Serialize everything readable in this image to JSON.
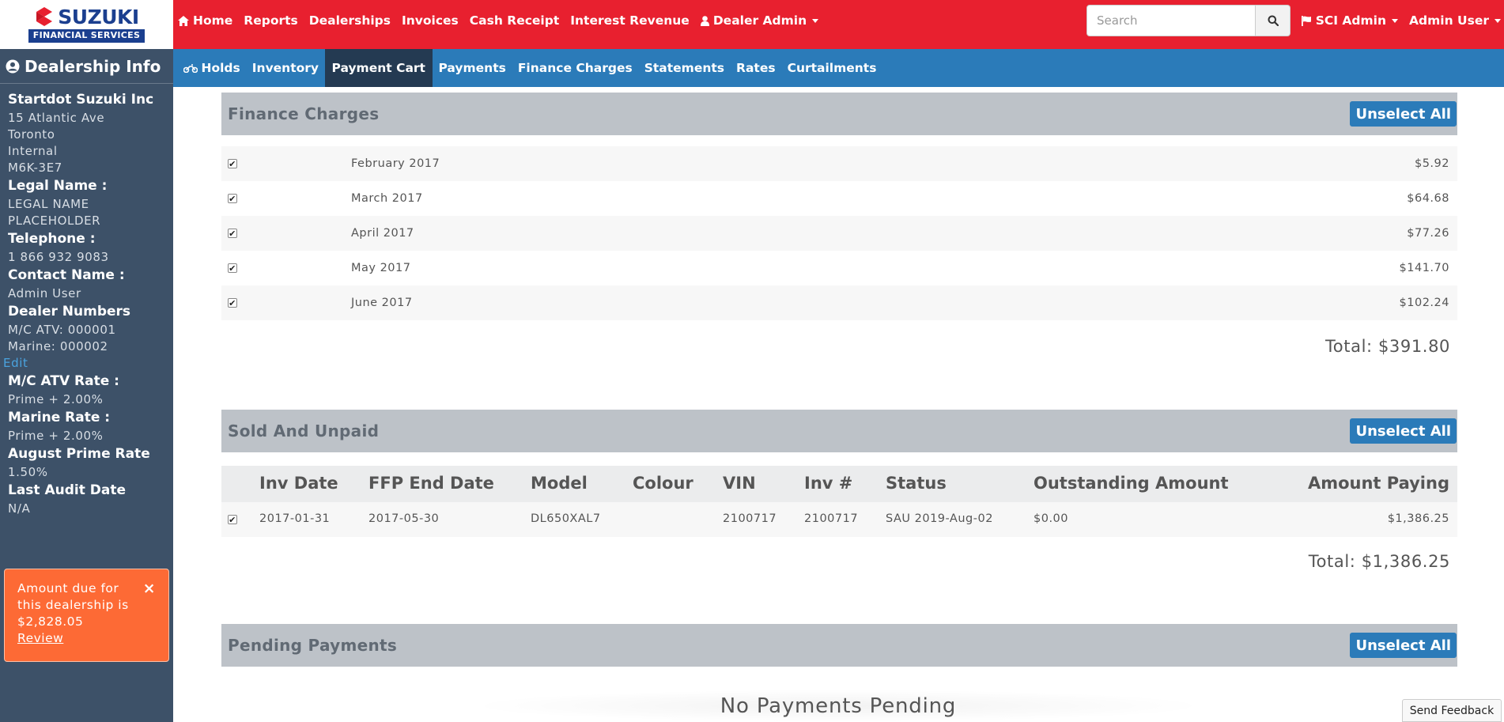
{
  "brand": {
    "name": "SUZUKI",
    "subtitle": "FINANCIAL SERVICES",
    "colors": {
      "red": "#e8202f",
      "blue": "#2b7bb9",
      "navy": "#1b3f8f",
      "sidebar": "#3d5168",
      "alert": "#fd6a35"
    }
  },
  "topnav": {
    "items": [
      {
        "label": "Home",
        "icon": "home-icon"
      },
      {
        "label": "Reports"
      },
      {
        "label": "Dealerships"
      },
      {
        "label": "Invoices"
      },
      {
        "label": "Cash Receipt"
      },
      {
        "label": "Interest Revenue"
      },
      {
        "label": "Dealer Admin",
        "icon": "user-icon",
        "dropdown": true
      }
    ],
    "search_placeholder": "Search",
    "right": [
      {
        "label": "SCI Admin",
        "icon": "flag-icon",
        "dropdown": true
      },
      {
        "label": "Admin User",
        "dropdown": true
      }
    ]
  },
  "subnav": {
    "items": [
      {
        "label": "Holds",
        "icon": "motorcycle-icon"
      },
      {
        "label": "Inventory"
      },
      {
        "label": "Payment Cart",
        "active": true
      },
      {
        "label": "Payments"
      },
      {
        "label": "Finance Charges"
      },
      {
        "label": "Statements"
      },
      {
        "label": "Rates"
      },
      {
        "label": "Curtailments"
      }
    ]
  },
  "sidebar": {
    "title": "Dealership Info",
    "dealer_name": "Startdot Suzuki Inc",
    "address": [
      "15 Atlantic Ave",
      "Toronto",
      "Internal",
      "M6K-3E7"
    ],
    "legal_label": "Legal Name :",
    "legal_value": [
      "LEGAL NAME",
      "PLACEHOLDER"
    ],
    "telephone_label": "Telephone :",
    "telephone_value": "1 866 932 9083",
    "contact_label": "Contact Name :",
    "contact_value": "Admin User",
    "dealer_numbers_label": "Dealer Numbers",
    "dealer_numbers": [
      "M/C ATV: 000001",
      "Marine: 000002"
    ],
    "edit_label": "Edit",
    "mc_rate_label": "M/C ATV Rate :",
    "mc_rate_value": "Prime + 2.00%",
    "marine_rate_label": "Marine Rate :",
    "marine_rate_value": "Prime + 2.00%",
    "prime_label": "August Prime Rate",
    "prime_value": "1.50%",
    "audit_label": "Last Audit Date",
    "audit_value": "N/A",
    "alert": {
      "lines": [
        "Amount due for",
        "this dealership is",
        "$2,828.05"
      ],
      "link": "Review",
      "close": "×"
    }
  },
  "finance_charges": {
    "title": "Finance Charges",
    "unselect_label": "Unselect All",
    "rows": [
      {
        "month": "February 2017",
        "amount": "$5.92",
        "checked": true
      },
      {
        "month": "March 2017",
        "amount": "$64.68",
        "checked": true
      },
      {
        "month": "April 2017",
        "amount": "$77.26",
        "checked": true
      },
      {
        "month": "May 2017",
        "amount": "$141.70",
        "checked": true
      },
      {
        "month": "June 2017",
        "amount": "$102.24",
        "checked": true
      }
    ],
    "total": "Total: $391.80"
  },
  "sold_unpaid": {
    "title": "Sold And Unpaid",
    "unselect_label": "Unselect All",
    "columns": [
      "Inv Date",
      "FFP End Date",
      "Model",
      "Colour",
      "VIN",
      "Inv #",
      "Status",
      "Outstanding Amount",
      "Amount Paying"
    ],
    "rows": [
      {
        "checked": true,
        "cells": [
          "2017-01-31",
          "2017-05-30",
          "DL650XAL7",
          "",
          "2100717",
          "2100717",
          "SAU 2019-Aug-02",
          "$0.00",
          "$1,386.25"
        ]
      }
    ],
    "total": "Total: $1,386.25"
  },
  "pending_payments": {
    "title": "Pending Payments",
    "unselect_label": "Unselect All",
    "empty": "No Payments Pending"
  },
  "feedback_label": "Send Feedback"
}
